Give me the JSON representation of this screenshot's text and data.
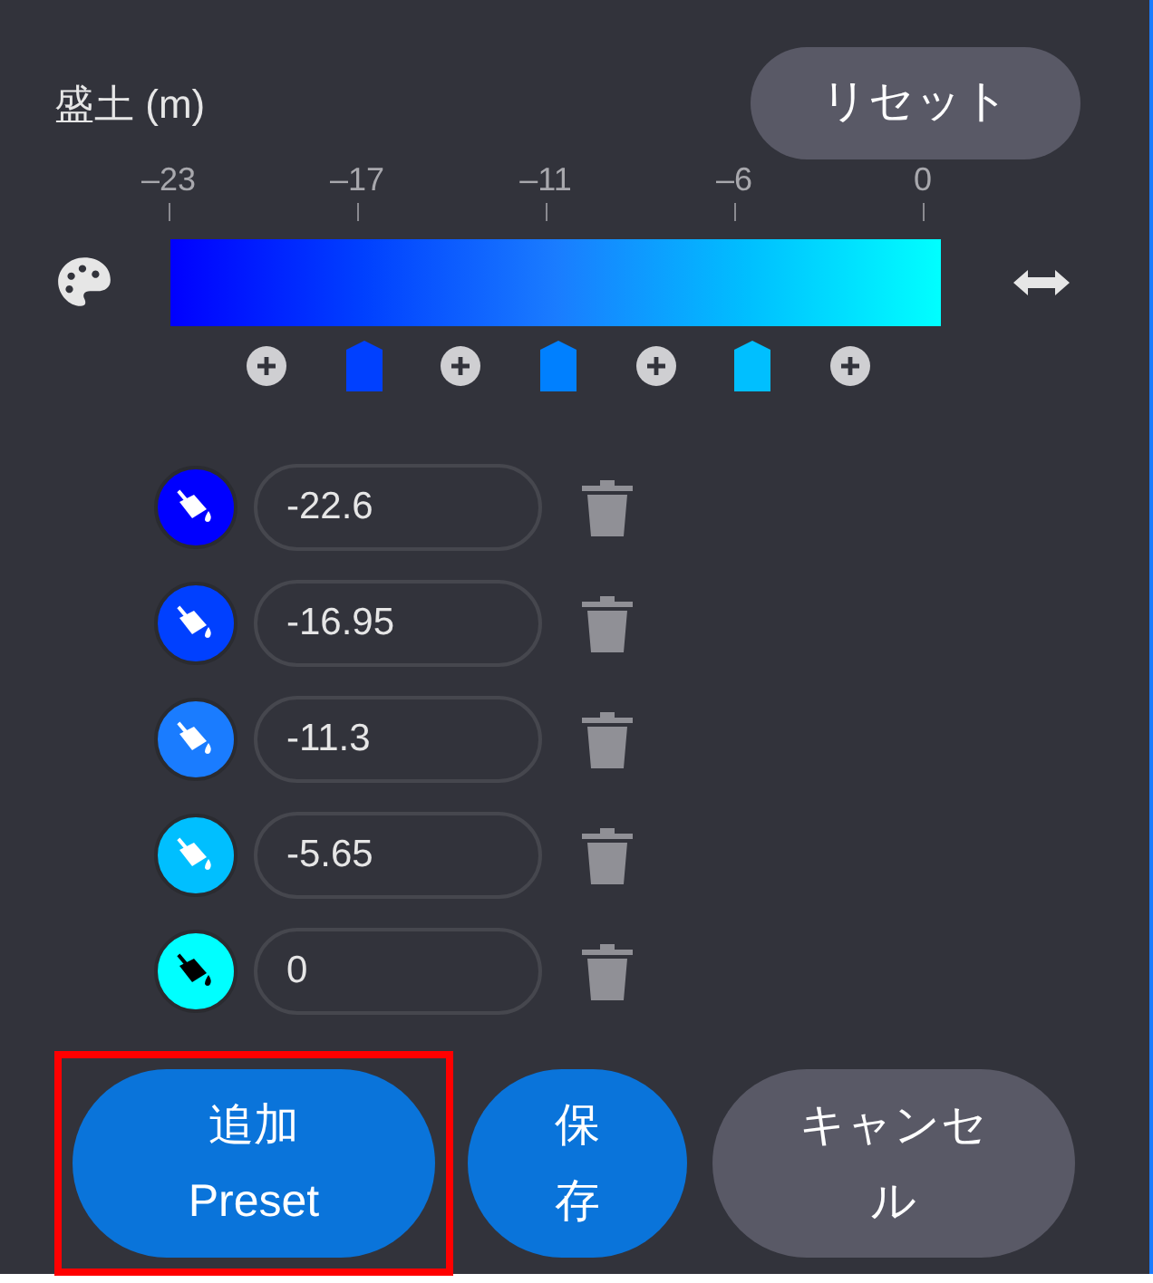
{
  "title": "盛土 (m)",
  "reset_button": "リセット",
  "scale_ticks": [
    "–23",
    "–17",
    "–11",
    "–6",
    "0"
  ],
  "markers": [
    {
      "kind": "add"
    },
    {
      "kind": "handle",
      "color": "#0040ff"
    },
    {
      "kind": "add"
    },
    {
      "kind": "handle",
      "color": "#0080ff"
    },
    {
      "kind": "add"
    },
    {
      "kind": "handle",
      "color": "#00bfff"
    },
    {
      "kind": "add"
    }
  ],
  "stops": [
    {
      "color": "#0000ff",
      "value": "-22.6"
    },
    {
      "color": "#0040ff",
      "value": "-16.95"
    },
    {
      "color": "#1a7cff",
      "value": "-11.3"
    },
    {
      "color": "#00bfff",
      "value": "-5.65"
    },
    {
      "color": "#00ffff",
      "value": "0"
    }
  ],
  "buttons": [
    {
      "kind": "primary",
      "label": "追加 Preset",
      "highlighted": true
    },
    {
      "kind": "primary",
      "label": "保存",
      "highlighted": false
    },
    {
      "kind": "secondary",
      "label": "キャンセル",
      "highlighted": false
    }
  ]
}
